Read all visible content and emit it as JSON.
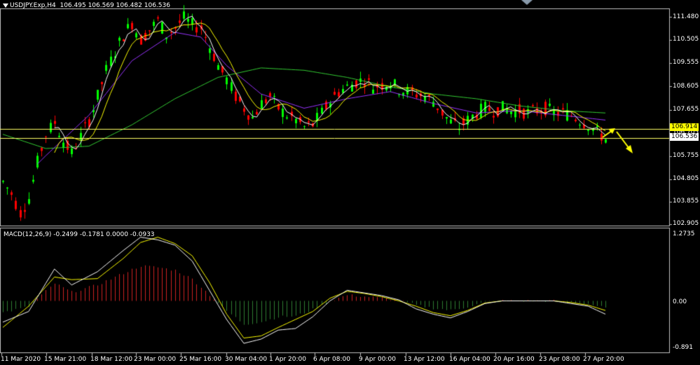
{
  "header": {
    "symbol": "USDJPY.Exp,H4",
    "open": "106.495",
    "high": "106.569",
    "low": "106.482",
    "close": "106.536"
  },
  "macd_header": {
    "label": "MACD(12,26,9)",
    "values": "-0.2499 -0.1781 0.0000 -0.0933"
  },
  "colors": {
    "background": "#000000",
    "grid_frame": "#c0c0c0",
    "bull_candle": "#00ff00",
    "bear_candle": "#ff0000",
    "ma_fast": "#ffffff",
    "ma_mid": "#ffff00",
    "ma_slow": "#9933ff",
    "ma_long": "#33cc33",
    "hline": "#ffff66",
    "arrow": "#ffff00",
    "macd_pos": "#cc2222",
    "macd_neg": "#2e7d32",
    "macd_main": "#ffffff",
    "macd_signal": "#ffff00"
  },
  "price_axis": {
    "ticks": [
      "111.480",
      "110.505",
      "109.555",
      "108.605",
      "107.655",
      "106.705",
      "105.755",
      "104.805",
      "103.855",
      "102.905"
    ],
    "hline_high": "106.914",
    "hline_low": "106.536"
  },
  "macd_axis": {
    "ticks": [
      "1.2735",
      "0.00",
      "-0.891"
    ]
  },
  "time_axis": {
    "labels": [
      "11 Mar 2020",
      "15 Mar 21:00",
      "18 Mar 12:00",
      "23 Mar 00:00",
      "25 Mar 16:00",
      "30 Mar 04:00",
      "1 Apr 20:00",
      "6 Apr 08:00",
      "9 Apr 00:00",
      "13 Apr 12:00",
      "16 Apr 04:00",
      "20 Apr 16:00",
      "23 Apr 08:00",
      "27 Apr 20:00"
    ]
  },
  "chart_data": {
    "type": "candlestick",
    "symbol": "USDJPY.Exp",
    "timeframe": "H4",
    "price_range": [
      102.85,
      111.95
    ],
    "price_path": [
      [
        0,
        104.7
      ],
      [
        2,
        104.2
      ],
      [
        4,
        103.4
      ],
      [
        6,
        104.0
      ],
      [
        8,
        105.5
      ],
      [
        10,
        106.7
      ],
      [
        12,
        107.2
      ],
      [
        14,
        106.4
      ],
      [
        16,
        105.9
      ],
      [
        18,
        106.6
      ],
      [
        20,
        107.3
      ],
      [
        22,
        108.3
      ],
      [
        24,
        109.4
      ],
      [
        26,
        110.2
      ],
      [
        28,
        110.9
      ],
      [
        30,
        111.4
      ],
      [
        32,
        110.7
      ],
      [
        34,
        111.1
      ],
      [
        36,
        111.5
      ],
      [
        38,
        110.9
      ],
      [
        40,
        111.2
      ],
      [
        42,
        111.6
      ],
      [
        44,
        111.3
      ],
      [
        46,
        111.2
      ],
      [
        48,
        110.4
      ],
      [
        50,
        109.6
      ],
      [
        52,
        109.0
      ],
      [
        54,
        108.3
      ],
      [
        56,
        107.8
      ],
      [
        58,
        107.4
      ],
      [
        60,
        108.0
      ],
      [
        62,
        108.3
      ],
      [
        64,
        107.8
      ],
      [
        66,
        107.5
      ],
      [
        68,
        107.3
      ],
      [
        70,
        107.0
      ],
      [
        72,
        107.1
      ],
      [
        74,
        107.6
      ],
      [
        76,
        108.1
      ],
      [
        78,
        108.5
      ],
      [
        80,
        108.7
      ],
      [
        82,
        108.9
      ],
      [
        84,
        109.0
      ],
      [
        86,
        108.7
      ],
      [
        88,
        108.8
      ],
      [
        90,
        108.9
      ],
      [
        92,
        108.6
      ],
      [
        94,
        108.5
      ],
      [
        96,
        108.4
      ],
      [
        98,
        108.3
      ],
      [
        100,
        108.1
      ],
      [
        102,
        107.6
      ],
      [
        104,
        107.2
      ],
      [
        106,
        107.0
      ],
      [
        108,
        107.3
      ],
      [
        110,
        107.6
      ],
      [
        112,
        107.8
      ],
      [
        114,
        107.7
      ],
      [
        116,
        107.8
      ],
      [
        118,
        107.7
      ],
      [
        120,
        107.7
      ],
      [
        122,
        107.6
      ],
      [
        124,
        107.7
      ],
      [
        126,
        107.8
      ],
      [
        128,
        107.6
      ],
      [
        130,
        107.6
      ],
      [
        132,
        107.5
      ],
      [
        134,
        107.3
      ],
      [
        136,
        107.1
      ],
      [
        138,
        106.8
      ],
      [
        140,
        106.5
      ]
    ],
    "macd_range": [
      -0.891,
      1.2735
    ],
    "macd_main_path": [
      [
        0,
        -0.4
      ],
      [
        6,
        -0.2
      ],
      [
        12,
        0.6
      ],
      [
        16,
        0.3
      ],
      [
        22,
        0.55
      ],
      [
        28,
        0.95
      ],
      [
        32,
        1.2
      ],
      [
        36,
        1.15
      ],
      [
        40,
        1.05
      ],
      [
        44,
        0.75
      ],
      [
        48,
        0.2
      ],
      [
        52,
        -0.35
      ],
      [
        56,
        -0.8
      ],
      [
        60,
        -0.72
      ],
      [
        64,
        -0.55
      ],
      [
        68,
        -0.52
      ],
      [
        72,
        -0.3
      ],
      [
        76,
        0.0
      ],
      [
        80,
        0.2
      ],
      [
        84,
        0.15
      ],
      [
        88,
        0.1
      ],
      [
        92,
        0.02
      ],
      [
        96,
        -0.15
      ],
      [
        100,
        -0.25
      ],
      [
        104,
        -0.32
      ],
      [
        108,
        -0.2
      ],
      [
        112,
        -0.05
      ],
      [
        116,
        0.0
      ],
      [
        120,
        0.0
      ],
      [
        124,
        0.0
      ],
      [
        128,
        0.0
      ],
      [
        132,
        -0.05
      ],
      [
        136,
        -0.1
      ],
      [
        140,
        -0.25
      ]
    ],
    "macd_signal_path": [
      [
        0,
        -0.5
      ],
      [
        6,
        -0.1
      ],
      [
        12,
        0.45
      ],
      [
        16,
        0.4
      ],
      [
        22,
        0.42
      ],
      [
        28,
        0.8
      ],
      [
        32,
        1.1
      ],
      [
        36,
        1.2
      ],
      [
        40,
        1.08
      ],
      [
        44,
        0.85
      ],
      [
        48,
        0.35
      ],
      [
        52,
        -0.25
      ],
      [
        56,
        -0.7
      ],
      [
        60,
        -0.66
      ],
      [
        64,
        -0.5
      ],
      [
        68,
        -0.35
      ],
      [
        72,
        -0.2
      ],
      [
        76,
        0.05
      ],
      [
        80,
        0.18
      ],
      [
        84,
        0.14
      ],
      [
        88,
        0.08
      ],
      [
        92,
        0.0
      ],
      [
        96,
        -0.1
      ],
      [
        100,
        -0.22
      ],
      [
        104,
        -0.28
      ],
      [
        108,
        -0.18
      ],
      [
        112,
        -0.04
      ],
      [
        116,
        0.0
      ],
      [
        120,
        0.0
      ],
      [
        124,
        0.0
      ],
      [
        128,
        0.0
      ],
      [
        132,
        -0.03
      ],
      [
        136,
        -0.08
      ],
      [
        140,
        -0.18
      ]
    ],
    "ma_long_path": [
      [
        0,
        106.7
      ],
      [
        10,
        106.1
      ],
      [
        20,
        106.2
      ],
      [
        30,
        107.1
      ],
      [
        40,
        108.2
      ],
      [
        50,
        109.1
      ],
      [
        60,
        109.5
      ],
      [
        70,
        109.4
      ],
      [
        80,
        109.1
      ],
      [
        90,
        108.7
      ],
      [
        100,
        108.4
      ],
      [
        110,
        108.2
      ],
      [
        120,
        107.9
      ],
      [
        130,
        107.7
      ],
      [
        140,
        107.6
      ]
    ],
    "ma_slow_path": [
      [
        0,
        104.0
      ],
      [
        10,
        105.8
      ],
      [
        20,
        107.5
      ],
      [
        30,
        109.8
      ],
      [
        40,
        111.0
      ],
      [
        46,
        110.8
      ],
      [
        52,
        109.6
      ],
      [
        60,
        108.4
      ],
      [
        70,
        107.8
      ],
      [
        80,
        108.2
      ],
      [
        90,
        108.5
      ],
      [
        100,
        108.0
      ],
      [
        110,
        107.6
      ],
      [
        120,
        107.7
      ],
      [
        130,
        107.5
      ],
      [
        140,
        107.3
      ]
    ]
  }
}
